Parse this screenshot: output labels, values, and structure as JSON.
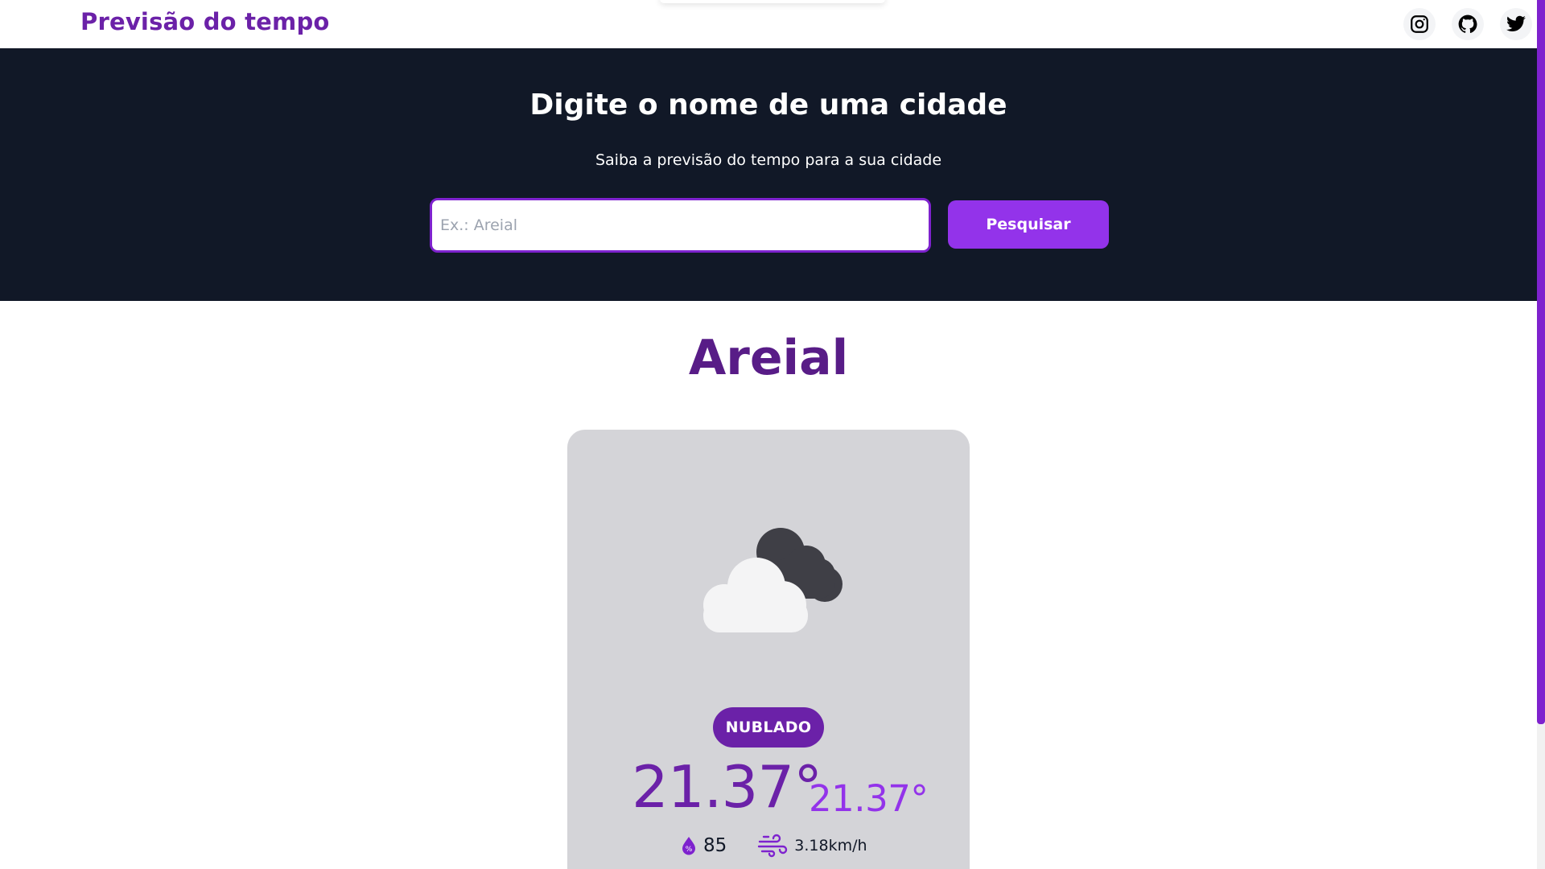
{
  "header": {
    "brand": "Previsão do tempo",
    "social_icons": [
      "instagram-icon",
      "github-icon",
      "twitter-icon"
    ]
  },
  "hero": {
    "title": "Digite o nome de uma cidade",
    "subtitle": "Saiba a previsão do tempo para a sua cidade",
    "search_placeholder": "Ex.: Areial",
    "search_value": "",
    "search_button": "Pesquisar"
  },
  "weather": {
    "city": "Areial",
    "icon": "cloudy-night-icon",
    "condition": "NUBLADO",
    "temperature": "21.37°",
    "temperature_secondary": "21.37°",
    "humidity": "85",
    "wind": "3.18km/h"
  },
  "colors": {
    "brand": "#6b21a8",
    "accent": "#9333ea",
    "hero_bg": "#111827",
    "card_bg": "#d4d4d8"
  }
}
